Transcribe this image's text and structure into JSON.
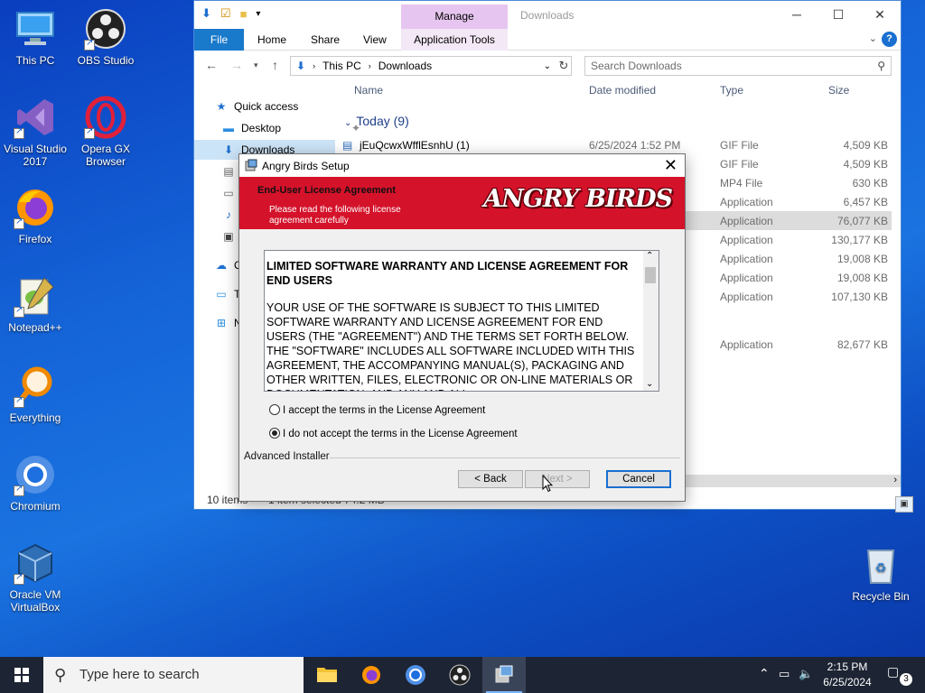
{
  "desktop": {
    "icons": [
      {
        "label": "This PC"
      },
      {
        "label": "OBS Studio"
      },
      {
        "label": "Visual Studio 2017"
      },
      {
        "label": "Opera GX Browser"
      },
      {
        "label": "Firefox"
      },
      {
        "label": "Notepad++"
      },
      {
        "label": "Everything"
      },
      {
        "label": "Chromium"
      },
      {
        "label": "Oracle VM VirtualBox"
      },
      {
        "label": "Recycle Bin"
      }
    ]
  },
  "explorer": {
    "context_tab": "Manage",
    "title": "Downloads",
    "ribbon_tabs": [
      "File",
      "Home",
      "Share",
      "View",
      "Application Tools"
    ],
    "breadcrumb": [
      "This PC",
      "Downloads"
    ],
    "search_placeholder": "Search Downloads",
    "nav": {
      "quick_access": "Quick access",
      "desktop": "Desktop",
      "downloads": "Downloads",
      "c": "C",
      "t": "T",
      "n": "N"
    },
    "columns": {
      "name": "Name",
      "date": "Date modified",
      "type": "Type",
      "size": "Size"
    },
    "group": "Today (9)",
    "rows": [
      {
        "name": "jEuQcwxWfflEsnhU (1)",
        "date": "6/25/2024 1:52 PM",
        "type": "GIF File",
        "size": "4,509 KB"
      },
      {
        "name": "",
        "date": "",
        "type": "GIF File",
        "size": "4,509 KB"
      },
      {
        "name": "",
        "date": "",
        "type": "MP4 File",
        "size": "630 KB"
      },
      {
        "name": "",
        "date": "",
        "type": "Application",
        "size": "6,457 KB"
      },
      {
        "name": "",
        "date": "",
        "type": "Application",
        "size": "76,077 KB"
      },
      {
        "name": "",
        "date": "",
        "type": "Application",
        "size": "130,177 KB"
      },
      {
        "name": "",
        "date": "",
        "type": "Application",
        "size": "19,008 KB"
      },
      {
        "name": "",
        "date": "",
        "type": "Application",
        "size": "19,008 KB"
      },
      {
        "name": "",
        "date": "",
        "type": "Application",
        "size": "107,130 KB"
      },
      {
        "name": "",
        "date": "",
        "type": "Application",
        "size": "82,677 KB"
      }
    ],
    "status_items": "10 items",
    "status_selected": "1 item selected  74.2 MB"
  },
  "dialog": {
    "title": "Angry Birds Setup",
    "heading": "End-User License Agreement",
    "subheading": "Please read the following license agreement carefully",
    "logo_text": "ANGRY BIRDS",
    "license_heading": "LIMITED SOFTWARE WARRANTY AND LICENSE AGREEMENT FOR END USERS",
    "license_body": "YOUR USE OF THE SOFTWARE IS SUBJECT TO THIS LIMITED SOFTWARE WARRANTY AND LICENSE AGREEMENT FOR END USERS (THE \"AGREEMENT\") AND THE TERMS SET FORTH BELOW. THE \"SOFTWARE\" INCLUDES ALL SOFTWARE INCLUDED WITH THIS AGREEMENT, THE ACCOMPANYING MANUAL(S), PACKAGING AND OTHER WRITTEN, FILES, ELECTRONIC OR ON-LINE MATERIALS OR DOCUMENTATION, AND ANY AND ALL",
    "accept": "I accept the terms in the License Agreement",
    "decline": "I do not accept the terms in the License Agreement",
    "selected_option": "decline",
    "vendor": "Advanced Installer",
    "back": "< Back",
    "next": "Next >",
    "cancel": "Cancel"
  },
  "taskbar": {
    "search_placeholder": "Type here to search",
    "time": "2:15 PM",
    "date": "6/25/2024",
    "notifications": "3"
  },
  "colors": {
    "banner_red": "#d4122a",
    "accent_blue": "#1979ca",
    "manage_purple": "#e6c6f0"
  }
}
